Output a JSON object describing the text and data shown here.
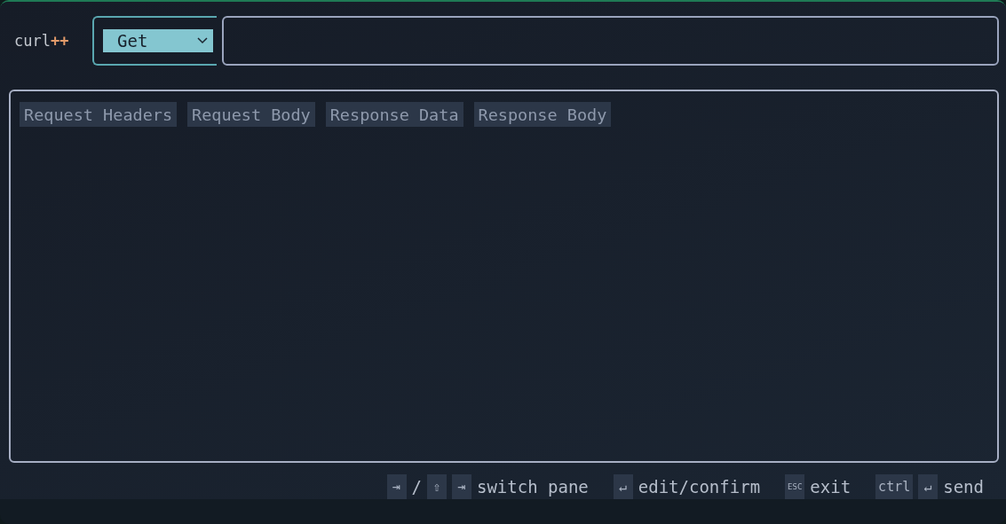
{
  "app": {
    "name": "curl",
    "accent": "++"
  },
  "method": {
    "value": "Get"
  },
  "tabs": [
    {
      "label": "Request Headers",
      "selected": false
    },
    {
      "label": "Request Body",
      "selected": false
    },
    {
      "label": "Response Data",
      "selected": false
    },
    {
      "label": "Response Body",
      "selected": false
    }
  ],
  "hints": [
    {
      "keys": [
        {
          "kind": "key",
          "text": "⇥"
        },
        {
          "kind": "separator",
          "text": "/"
        },
        {
          "kind": "key",
          "text": "⇧"
        },
        {
          "kind": "key",
          "text": "⇥"
        }
      ],
      "label": "switch pane"
    },
    {
      "keys": [
        {
          "kind": "key",
          "text": "↵"
        }
      ],
      "label": "edit/confirm"
    },
    {
      "keys": [
        {
          "kind": "small-key",
          "text": "ESC"
        }
      ],
      "label": "exit"
    },
    {
      "keys": [
        {
          "kind": "key",
          "text": "ctrl"
        },
        {
          "kind": "key",
          "text": "↵"
        }
      ],
      "label": "send"
    }
  ]
}
